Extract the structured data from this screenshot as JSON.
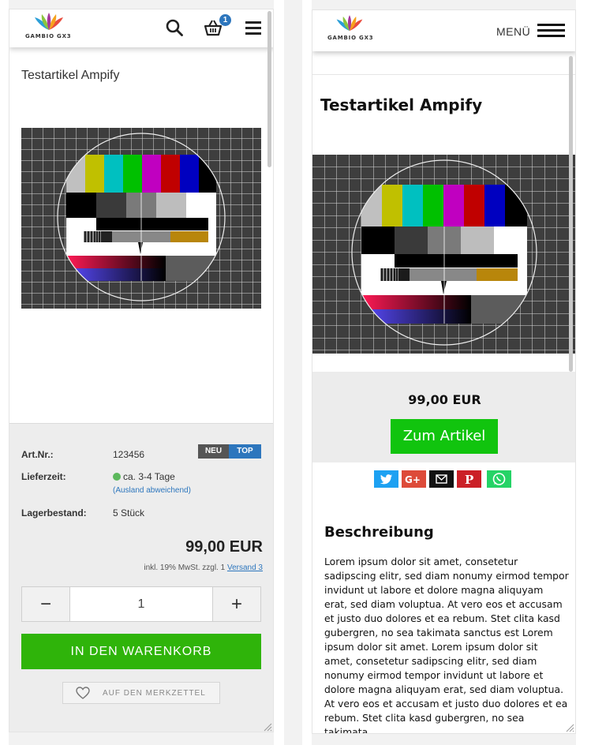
{
  "left": {
    "logo_text": "GAMBIO GX3",
    "cart_count": "1",
    "product_title": "Testartikel Ampify",
    "details": {
      "artnr_label": "Art.Nr.:",
      "artnr_value": "123456",
      "delivery_label": "Lieferzeit:",
      "delivery_value": "ca. 3-4 Tage",
      "delivery_note": "(Ausland abweichend)",
      "stock_label": "Lagerbestand:",
      "stock_value": "5 Stück"
    },
    "badges": {
      "new": "NEU",
      "top": "TOP"
    },
    "price": "99,00 EUR",
    "tax_text": "inkl. 19% MwSt. zzgl. 1",
    "shipping_link": "Versand 3",
    "quantity": "1",
    "minus": "−",
    "plus": "+",
    "cart_button": "IN DEN WARENKORB",
    "wishlist_button": "AUF DEN MERKZETTEL"
  },
  "right": {
    "logo_text": "GAMBIO GX3",
    "menu_label": "MENÜ",
    "product_title": "Testartikel Ampify",
    "price": "99,00 EUR",
    "button": "Zum Artikel",
    "share_icons": [
      "twitter-icon",
      "google-plus-icon",
      "email-icon",
      "pinterest-icon",
      "whatsapp-icon"
    ],
    "share_colors": [
      "#1da1f2",
      "#dd4b39",
      "#111111",
      "#cb2027",
      "#25d366"
    ],
    "description_heading": "Beschreibung",
    "description_text": "Lorem ipsum dolor sit amet, consetetur sadipscing elitr, sed diam nonumy eirmod tempor invidunt ut labore et dolore magna aliquyam erat, sed diam voluptua. At vero eos et accusam et justo duo dolores et ea rebum. Stet clita kasd gubergren, no sea takimata sanctus est Lorem ipsum dolor sit amet. Lorem ipsum dolor sit amet, consetetur sadipscing elitr, sed diam nonumy eirmod tempor invidunt ut labore et dolore magna aliquyam erat, sed diam voluptua. At vero eos et accusam et justo duo dolores et ea rebum. Stet clita kasd gubergren, no sea takimata"
  },
  "colors": {
    "green_button": "#2fb40a",
    "green_button_amp": "#11c40e",
    "link_blue": "#2d76bd",
    "badge_new": "#555555",
    "badge_top": "#2d76bd"
  }
}
